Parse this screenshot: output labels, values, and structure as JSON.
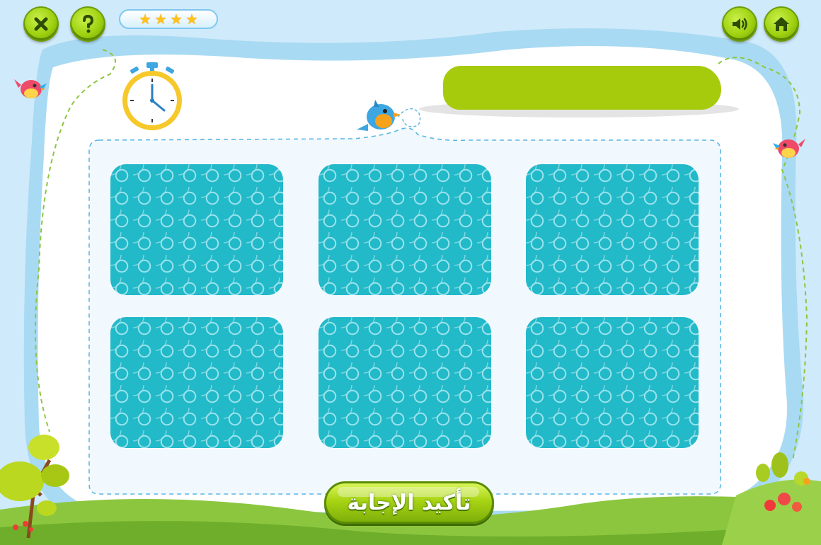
{
  "top_bar": {
    "close_icon": "close-icon",
    "help_icon": "help-icon",
    "sound_icon": "speaker-icon",
    "home_icon": "home-icon",
    "stars_count": 4
  },
  "timer_icon": "stopwatch-icon",
  "title_text": "",
  "cards": [
    {
      "id": 1,
      "state": "face-down"
    },
    {
      "id": 2,
      "state": "face-down"
    },
    {
      "id": 3,
      "state": "face-down"
    },
    {
      "id": 4,
      "state": "face-down"
    },
    {
      "id": 5,
      "state": "face-down"
    },
    {
      "id": 6,
      "state": "face-down"
    }
  ],
  "confirm_button": {
    "label": "تأكيد الإجابة"
  },
  "colors": {
    "button_green": "#9ed10f",
    "card_teal": "#22b9c9",
    "sky_blue": "#cfeafa",
    "grass_green": "#8cc63f",
    "title_bar_green": "#a6cb0c"
  }
}
